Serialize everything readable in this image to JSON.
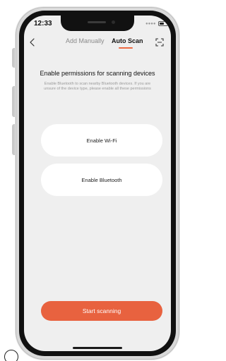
{
  "status_bar": {
    "time": "12:33",
    "signal_icon": "signal-dots-icon",
    "battery_icon": "battery-icon"
  },
  "nav": {
    "back_icon": "back-arrow-icon",
    "tabs": [
      {
        "label": "Add Manually",
        "active": false
      },
      {
        "label": "Auto Scan",
        "active": true
      }
    ],
    "scan_icon": "scan-frame-icon",
    "accent_color": "#ee6a42"
  },
  "permissions": {
    "title": "Enable permissions for scanning devices",
    "description": "Enable Bluetooth to scan nearby Bluetooth devices. If you are unsure of the device type, please enable all these permissions"
  },
  "actions": {
    "wifi_label": "Enable Wi-Fi",
    "bluetooth_label": "Enable Bluetooth",
    "start_label": "Start scanning",
    "start_color": "#e8623f"
  }
}
